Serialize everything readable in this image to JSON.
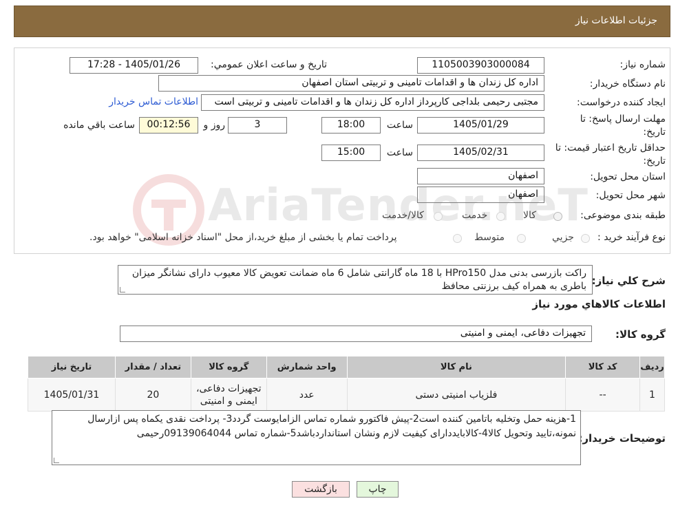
{
  "header": {
    "title": "جزئیات اطلاعات نیاز"
  },
  "fields": {
    "need_number_label": "شماره نیاز:",
    "need_number": "1105003903000084",
    "announce_label": "تاریخ و ساعت اعلان عمومي:",
    "announce_value": "1405/01/26 - 17:28",
    "buyer_org_label": "نام دستگاه خریدار:",
    "buyer_org": "اداره کل زندان ها و اقدامات تامینی و تربیتی استان اصفهان",
    "creator_label": "ایجاد کننده درخواست:",
    "creator": "مجتبی رحیمی بلداجی کارپرداز اداره کل زندان ها و اقدامات تامینی و تربیتی است",
    "contact_link": "اطلاعات تماس خریدار",
    "deadline_label_1": "مهلت ارسال پاسخ: تا",
    "deadline_label_2": "تاریخ:",
    "deadline_date": "1405/01/29",
    "time_label": "ساعت",
    "deadline_time": "18:00",
    "days_value": "3",
    "days_label": "روز و",
    "remaining_time": "00:12:56",
    "remaining_label": "ساعت باقي مانده",
    "validity_label_1": "حداقل تاریخ اعتبار قیمت: تا",
    "validity_label_2": "تاریخ:",
    "validity_date": "1405/02/31",
    "validity_time": "15:00",
    "province_label": "استان محل تحویل:",
    "province": "اصفهان",
    "city_label": "شهر محل تحویل:",
    "city": "اصفهان",
    "category_label": "طبقه بندی موضوعی:",
    "category_options": [
      "کالا",
      "خدمت",
      "کالا/خدمت"
    ],
    "purchase_type_label": "نوع فرآیند خرید :",
    "purchase_options": [
      "جزيي",
      "متوسط"
    ],
    "purchase_note": "پرداخت تمام یا بخشی از مبلغ خرید،از محل \"اسناد خزانه اسلامی\" خواهد بود."
  },
  "watermark": {
    "text": "AriaTender.neT"
  },
  "description": {
    "label": "شرح کلي نياز:",
    "text": "راکت بازرسی بدنی مدل HPro150 با 18 ماه گارانتی شامل 6 ماه ضمانت تعویض کالا معیوب  دارای نشانگر میزان باطری به همراه کیف برزنتی محافظ"
  },
  "goods_section": {
    "title": "اطلاعات کالاهاي مورد نياز",
    "group_label": "گروه کالا:",
    "group_value": "تجهیزات دفاعی، ایمنی و امنیتی"
  },
  "table": {
    "headers": [
      "رديف",
      "کد کالا",
      "نام کالا",
      "واحد شمارش",
      "گروه کالا",
      "تعداد / مقدار",
      "تاريخ نياز"
    ],
    "rows": [
      [
        "1",
        "--",
        "فلزیاب امنیتی دستی",
        "عدد",
        "تجهیزات دفاعی، ایمنی و امنیتی",
        "20",
        "1405/01/31"
      ]
    ]
  },
  "notes": {
    "label": "توضيحات خريدار:",
    "text": "1-هزینه حمل وتخلیه باتامین کننده است2-پیش فاکتورو شماره تماس الزامایوست گردد3- پرداخت نقدی یکماه  پس ازارسال نمونه،تایید وتحویل کالا4-کالابایددارای کیفیت لازم ونشان استانداردباشد5-شماره تماس 09139064044رحیمی"
  },
  "buttons": {
    "print": "چاپ",
    "back": "بازگشت"
  }
}
